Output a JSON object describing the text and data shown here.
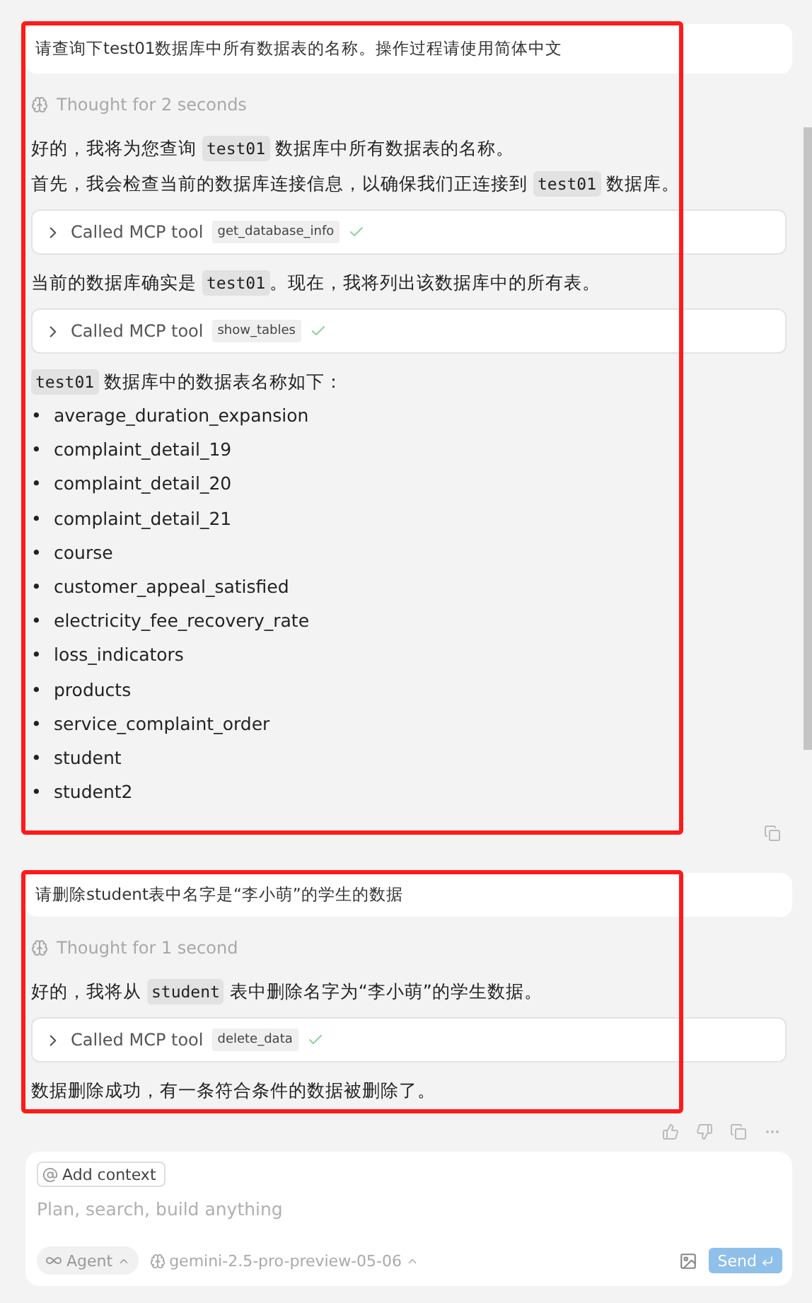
{
  "turns": [
    {
      "highlighted": true,
      "user_message": "请查询下test01数据库中所有数据表的名称。操作过程请使用简体中文",
      "thought": "Thought for 2 seconds",
      "blocks": [
        {
          "kind": "paragraph",
          "parts": [
            {
              "kind": "text",
              "text": "好的，我将为您查询 "
            },
            {
              "kind": "code",
              "text": "test01"
            },
            {
              "kind": "text",
              "text": " 数据库中所有数据表的名称。"
            }
          ]
        },
        {
          "kind": "paragraph",
          "parts": [
            {
              "kind": "text",
              "text": "首先，我会检查当前的数据库连接信息，以确保我们正连接到 "
            },
            {
              "kind": "code",
              "text": "test01"
            },
            {
              "kind": "text",
              "text": " 数据库。"
            }
          ]
        },
        {
          "kind": "tool",
          "label": "Called MCP tool",
          "tool": "get_database_info",
          "done": true
        },
        {
          "kind": "paragraph",
          "parts": [
            {
              "kind": "text",
              "text": "当前的数据库确实是 "
            },
            {
              "kind": "code",
              "text": "test01"
            },
            {
              "kind": "text",
              "text": "。现在，我将列出该数据库中的所有表。"
            }
          ]
        },
        {
          "kind": "tool",
          "label": "Called MCP tool",
          "tool": "show_tables",
          "done": true
        },
        {
          "kind": "paragraph",
          "parts": [
            {
              "kind": "code",
              "text": "test01"
            },
            {
              "kind": "text",
              "text": " 数据库中的数据表名称如下："
            }
          ]
        },
        {
          "kind": "list",
          "marker": "•",
          "items": [
            "average_duration_expansion",
            "complaint_detail_19",
            "complaint_detail_20",
            "complaint_detail_21",
            "course",
            "customer_appeal_satisfied",
            "electricity_fee_recovery_rate",
            "loss_indicators",
            "products",
            "service_complaint_order",
            "student",
            "student2"
          ]
        }
      ],
      "actions": [
        {
          "kind": "copy"
        }
      ]
    },
    {
      "highlighted": true,
      "user_message": "请删除student表中名字是“李小萌”的学生的数据",
      "thought": "Thought for 1 second",
      "blocks": [
        {
          "kind": "paragraph",
          "parts": [
            {
              "kind": "text",
              "text": "好的，我将从 "
            },
            {
              "kind": "code",
              "text": "student"
            },
            {
              "kind": "text",
              "text": " 表中删除名字为“李小萌”的学生数据。"
            }
          ]
        },
        {
          "kind": "tool",
          "label": "Called MCP tool",
          "tool": "delete_data",
          "done": true
        },
        {
          "kind": "paragraph",
          "parts": [
            {
              "kind": "text",
              "text": "数据删除成功，有一条符合条件的数据被删除了。"
            }
          ]
        }
      ],
      "actions": [
        {
          "kind": "thumbs_up"
        },
        {
          "kind": "thumbs_down"
        },
        {
          "kind": "copy"
        },
        {
          "kind": "more"
        }
      ]
    }
  ],
  "composer": {
    "add_context": "Add context",
    "placeholder": "Plan, search, build anything",
    "mode": "Agent",
    "model": "gemini-2.5-pro-preview-05-06",
    "send": "Send"
  }
}
